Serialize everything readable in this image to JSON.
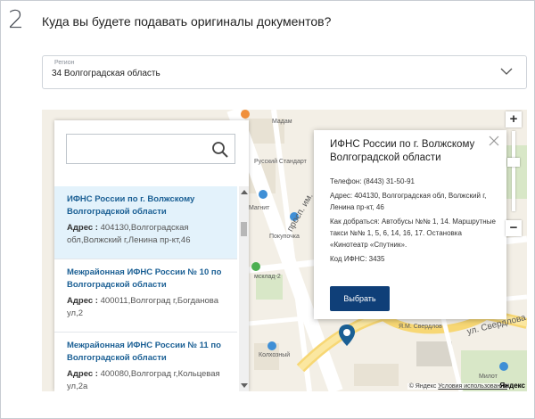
{
  "step": {
    "number": "2",
    "title": "Куда вы будете подавать оригиналы документов?"
  },
  "region": {
    "caption": "Регион",
    "value": "34 Волгоградская область"
  },
  "search": {
    "placeholder": "",
    "value": ""
  },
  "offices": [
    {
      "title": "ИФНС России по г. Волжскому Волгоградской области",
      "address_label": "Адрес :",
      "address": "404130,Волгоградская обл,Волжский г,Ленина пр-кт,46",
      "selected": true
    },
    {
      "title": "Межрайонная ИФНС России № 10 по Волгоградской области",
      "address_label": "Адрес :",
      "address": "400011,Волгоград г,Богданова ул,2",
      "selected": false
    },
    {
      "title": "Межрайонная ИФНС России № 11 по Волгоградской области",
      "address_label": "Адрес :",
      "address": "400080,Волгоград г,Кольцевая ул,2а",
      "selected": false
    }
  ],
  "balloon": {
    "title": "ИФНС России по г. Волжскому Волгоградской области",
    "phone": "Телефон: (8443) 31-50-91",
    "address": "Адрес: 404130, Волгоградская обл, Волжский г, Ленина пр-кт, 46",
    "directions": "Как добраться: Автобусы №№ 1, 14. Маршрутные такси №№ 1, 5, 6, 14, 16, 17. Остановка «Кинотеатр «Спутник».",
    "ifns_code": "Код ИФНС: 3435",
    "button_label": "Выбрать"
  },
  "map": {
    "labels": {
      "madam": "Мадам",
      "standart": "Русский Стандарт",
      "magnit": "Магнит",
      "prospect": "просп. им.",
      "pokupochka": "Покупочка",
      "medservice": "мсклад-2",
      "kolkhozny": "Колхозный",
      "yam_sverdlov": "Я.М. Свердлов",
      "sverdlova": "ул. Свердлова",
      "milot": "Милот"
    },
    "zoom_in": "+",
    "zoom_out": "−",
    "copyright": "© Яндекс",
    "terms": "Условия использования",
    "logo": "Яндекс"
  },
  "colors": {
    "accent": "#0f3f78",
    "link": "#1a5f94",
    "selected_row": "#e3f2fb",
    "marker": "#1a5f94"
  }
}
